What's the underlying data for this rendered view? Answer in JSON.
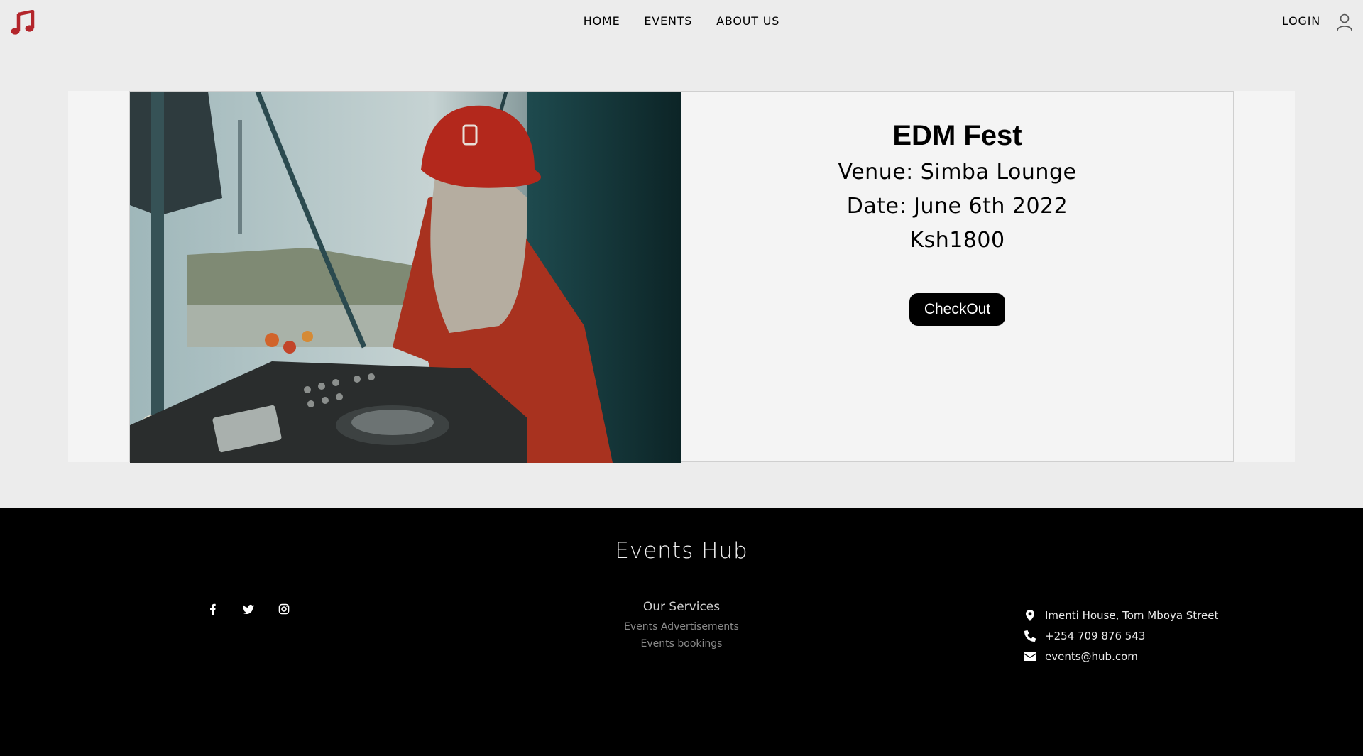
{
  "nav": {
    "items": [
      "HOME",
      "EVENTS",
      "ABOUT US"
    ],
    "login": "LOGIN"
  },
  "event": {
    "title": "EDM Fest",
    "venue": "Venue: Simba Lounge",
    "date": "Date: June 6th 2022",
    "price": "Ksh1800",
    "checkout_label": "CheckOut"
  },
  "footer": {
    "brand": "Events Hub",
    "services_heading": "Our Services",
    "services": [
      "Events Advertisements",
      "Events bookings"
    ],
    "address": "Imenti House, Tom Mboya Street",
    "phone": "+254 709 876 543",
    "email": "events@hub.com",
    "social": [
      "facebook-icon",
      "twitter-icon",
      "instagram-icon"
    ]
  },
  "colors": {
    "logo": "#b3252b",
    "footer_bg": "#000000",
    "button_bg": "#000000"
  }
}
